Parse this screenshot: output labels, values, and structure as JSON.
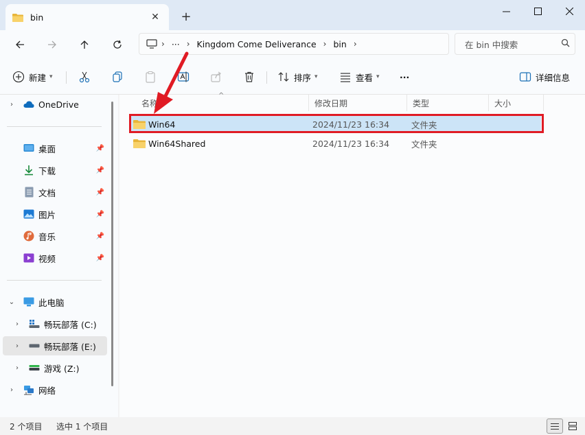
{
  "tab": {
    "title": "bin",
    "close": "✕",
    "new": "+"
  },
  "window": {
    "minimize": "—",
    "maximize": "☐",
    "close": "✕"
  },
  "address": {
    "ellipsis": "···",
    "crumbs": [
      "Kingdom Come Deliverance",
      "bin"
    ],
    "sep": "›",
    "search_placeholder": "在 bin 中搜索"
  },
  "toolbar": {
    "new_label": "新建",
    "sort_label": "排序",
    "view_label": "查看",
    "more_label": "···",
    "details_label": "详细信息"
  },
  "sidebar": {
    "onedrive": "OneDrive",
    "quick": [
      {
        "label": "桌面"
      },
      {
        "label": "下载"
      },
      {
        "label": "文档"
      },
      {
        "label": "图片"
      },
      {
        "label": "音乐"
      },
      {
        "label": "视频"
      }
    ],
    "thispc": "此电脑",
    "drives": [
      {
        "label": "畅玩部落 (C:)"
      },
      {
        "label": "畅玩部落 (E:)"
      },
      {
        "label": "游戏 (Z:)"
      }
    ],
    "network": "网络"
  },
  "columns": {
    "name": "名称",
    "date": "修改日期",
    "type": "类型",
    "size": "大小"
  },
  "files": [
    {
      "name": "Win64",
      "date": "2024/11/23 16:34",
      "type": "文件夹"
    },
    {
      "name": "Win64Shared",
      "date": "2024/11/23 16:34",
      "type": "文件夹"
    }
  ],
  "status": {
    "count": "2 个项目",
    "selected": "选中 1 个项目"
  },
  "colors": {
    "accent": "#0067c0",
    "selection": "#cce4f7",
    "highlight": "#e01b24",
    "folder": "#f5c84c"
  }
}
